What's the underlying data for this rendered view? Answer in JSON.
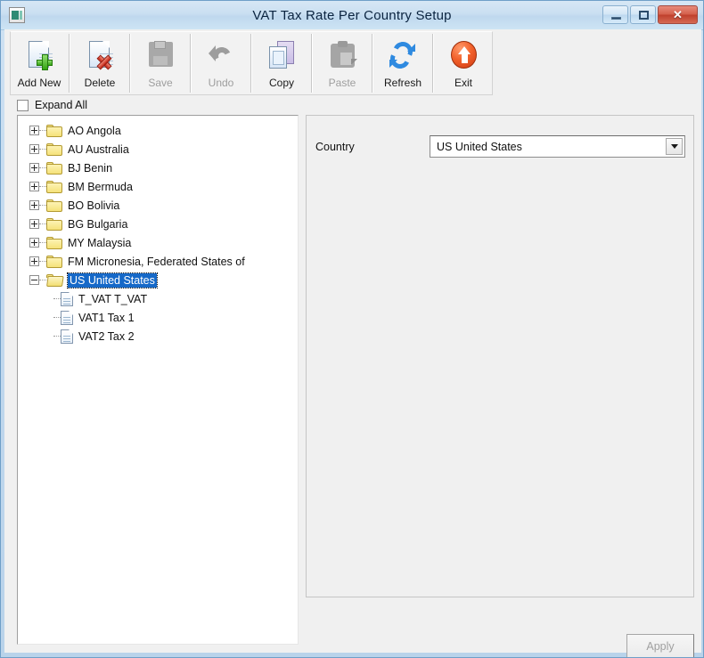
{
  "window": {
    "title": "VAT Tax Rate Per Country Setup",
    "app_icon": "application-icon",
    "controls": {
      "minimize": "–",
      "maximize": "□",
      "close": "✕"
    }
  },
  "toolbar": {
    "buttons": [
      {
        "label": "Add New",
        "icon": "document-add-icon",
        "enabled": true
      },
      {
        "label": "Delete",
        "icon": "document-delete-icon",
        "enabled": true
      },
      {
        "label": "Save",
        "icon": "save-icon",
        "enabled": false
      },
      {
        "label": "Undo",
        "icon": "undo-arrow-icon",
        "enabled": false
      },
      {
        "label": "Copy",
        "icon": "copy-documents-icon",
        "enabled": true
      },
      {
        "label": "Paste",
        "icon": "clipboard-paste-icon",
        "enabled": false
      },
      {
        "label": "Refresh",
        "icon": "refresh-arrows-icon",
        "enabled": true
      },
      {
        "label": "Exit",
        "icon": "exit-up-arrow-icon",
        "enabled": true
      }
    ]
  },
  "expand_all": {
    "label": "Expand All",
    "checked": false
  },
  "tree": {
    "nodes": [
      {
        "label": "AO Angola",
        "icon": "folder-icon",
        "expanded": false,
        "selected": false,
        "level": 0
      },
      {
        "label": "AU Australia",
        "icon": "folder-icon",
        "expanded": false,
        "selected": false,
        "level": 0
      },
      {
        "label": "BJ Benin",
        "icon": "folder-icon",
        "expanded": false,
        "selected": false,
        "level": 0
      },
      {
        "label": "BM Bermuda",
        "icon": "folder-icon",
        "expanded": false,
        "selected": false,
        "level": 0
      },
      {
        "label": "BO Bolivia",
        "icon": "folder-icon",
        "expanded": false,
        "selected": false,
        "level": 0
      },
      {
        "label": "BG Bulgaria",
        "icon": "folder-icon",
        "expanded": false,
        "selected": false,
        "level": 0
      },
      {
        "label": "MY Malaysia",
        "icon": "folder-icon",
        "expanded": false,
        "selected": false,
        "level": 0
      },
      {
        "label": "FM Micronesia, Federated States of",
        "icon": "folder-icon",
        "expanded": false,
        "selected": false,
        "level": 0
      },
      {
        "label": "US United States",
        "icon": "folder-open-icon",
        "expanded": true,
        "selected": true,
        "level": 0
      },
      {
        "label": "T_VAT T_VAT",
        "icon": "document-icon",
        "expanded": null,
        "selected": false,
        "level": 1
      },
      {
        "label": "VAT1 Tax 1",
        "icon": "document-icon",
        "expanded": null,
        "selected": false,
        "level": 1
      },
      {
        "label": "VAT2 Tax 2",
        "icon": "document-icon",
        "expanded": null,
        "selected": false,
        "level": 1
      }
    ]
  },
  "detail": {
    "country": {
      "label": "Country",
      "value": "US United States",
      "dropdown_icon": "chevron-down-icon"
    }
  },
  "footer": {
    "apply_label": "Apply",
    "apply_enabled": false
  },
  "colors": {
    "titlebar": "#c9dff1",
    "selection": "#1669c8",
    "folder": "#f5e27a",
    "close_button": "#cf3a13",
    "client_background": "#f0f0f0"
  }
}
